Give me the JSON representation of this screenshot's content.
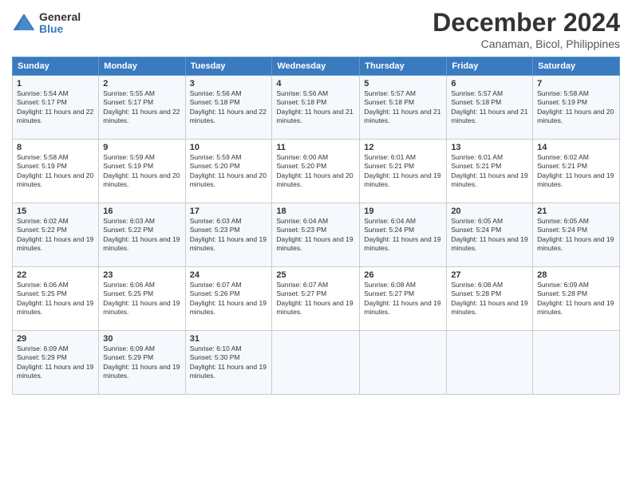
{
  "header": {
    "logo_line1": "General",
    "logo_line2": "Blue",
    "month": "December 2024",
    "location": "Canaman, Bicol, Philippines"
  },
  "weekdays": [
    "Sunday",
    "Monday",
    "Tuesday",
    "Wednesday",
    "Thursday",
    "Friday",
    "Saturday"
  ],
  "weeks": [
    [
      {
        "day": "1",
        "sunrise": "5:54 AM",
        "sunset": "5:17 PM",
        "daylight": "11 hours and 22 minutes."
      },
      {
        "day": "2",
        "sunrise": "5:55 AM",
        "sunset": "5:17 PM",
        "daylight": "11 hours and 22 minutes."
      },
      {
        "day": "3",
        "sunrise": "5:56 AM",
        "sunset": "5:18 PM",
        "daylight": "11 hours and 22 minutes."
      },
      {
        "day": "4",
        "sunrise": "5:56 AM",
        "sunset": "5:18 PM",
        "daylight": "11 hours and 21 minutes."
      },
      {
        "day": "5",
        "sunrise": "5:57 AM",
        "sunset": "5:18 PM",
        "daylight": "11 hours and 21 minutes."
      },
      {
        "day": "6",
        "sunrise": "5:57 AM",
        "sunset": "5:18 PM",
        "daylight": "11 hours and 21 minutes."
      },
      {
        "day": "7",
        "sunrise": "5:58 AM",
        "sunset": "5:19 PM",
        "daylight": "11 hours and 20 minutes."
      }
    ],
    [
      {
        "day": "8",
        "sunrise": "5:58 AM",
        "sunset": "5:19 PM",
        "daylight": "11 hours and 20 minutes."
      },
      {
        "day": "9",
        "sunrise": "5:59 AM",
        "sunset": "5:19 PM",
        "daylight": "11 hours and 20 minutes."
      },
      {
        "day": "10",
        "sunrise": "5:59 AM",
        "sunset": "5:20 PM",
        "daylight": "11 hours and 20 minutes."
      },
      {
        "day": "11",
        "sunrise": "6:00 AM",
        "sunset": "5:20 PM",
        "daylight": "11 hours and 20 minutes."
      },
      {
        "day": "12",
        "sunrise": "6:01 AM",
        "sunset": "5:21 PM",
        "daylight": "11 hours and 19 minutes."
      },
      {
        "day": "13",
        "sunrise": "6:01 AM",
        "sunset": "5:21 PM",
        "daylight": "11 hours and 19 minutes."
      },
      {
        "day": "14",
        "sunrise": "6:02 AM",
        "sunset": "5:21 PM",
        "daylight": "11 hours and 19 minutes."
      }
    ],
    [
      {
        "day": "15",
        "sunrise": "6:02 AM",
        "sunset": "5:22 PM",
        "daylight": "11 hours and 19 minutes."
      },
      {
        "day": "16",
        "sunrise": "6:03 AM",
        "sunset": "5:22 PM",
        "daylight": "11 hours and 19 minutes."
      },
      {
        "day": "17",
        "sunrise": "6:03 AM",
        "sunset": "5:23 PM",
        "daylight": "11 hours and 19 minutes."
      },
      {
        "day": "18",
        "sunrise": "6:04 AM",
        "sunset": "5:23 PM",
        "daylight": "11 hours and 19 minutes."
      },
      {
        "day": "19",
        "sunrise": "6:04 AM",
        "sunset": "5:24 PM",
        "daylight": "11 hours and 19 minutes."
      },
      {
        "day": "20",
        "sunrise": "6:05 AM",
        "sunset": "5:24 PM",
        "daylight": "11 hours and 19 minutes."
      },
      {
        "day": "21",
        "sunrise": "6:05 AM",
        "sunset": "5:24 PM",
        "daylight": "11 hours and 19 minutes."
      }
    ],
    [
      {
        "day": "22",
        "sunrise": "6:06 AM",
        "sunset": "5:25 PM",
        "daylight": "11 hours and 19 minutes."
      },
      {
        "day": "23",
        "sunrise": "6:06 AM",
        "sunset": "5:25 PM",
        "daylight": "11 hours and 19 minutes."
      },
      {
        "day": "24",
        "sunrise": "6:07 AM",
        "sunset": "5:26 PM",
        "daylight": "11 hours and 19 minutes."
      },
      {
        "day": "25",
        "sunrise": "6:07 AM",
        "sunset": "5:27 PM",
        "daylight": "11 hours and 19 minutes."
      },
      {
        "day": "26",
        "sunrise": "6:08 AM",
        "sunset": "5:27 PM",
        "daylight": "11 hours and 19 minutes."
      },
      {
        "day": "27",
        "sunrise": "6:08 AM",
        "sunset": "5:28 PM",
        "daylight": "11 hours and 19 minutes."
      },
      {
        "day": "28",
        "sunrise": "6:09 AM",
        "sunset": "5:28 PM",
        "daylight": "11 hours and 19 minutes."
      }
    ],
    [
      {
        "day": "29",
        "sunrise": "6:09 AM",
        "sunset": "5:29 PM",
        "daylight": "11 hours and 19 minutes."
      },
      {
        "day": "30",
        "sunrise": "6:09 AM",
        "sunset": "5:29 PM",
        "daylight": "11 hours and 19 minutes."
      },
      {
        "day": "31",
        "sunrise": "6:10 AM",
        "sunset": "5:30 PM",
        "daylight": "11 hours and 19 minutes."
      },
      null,
      null,
      null,
      null
    ]
  ]
}
